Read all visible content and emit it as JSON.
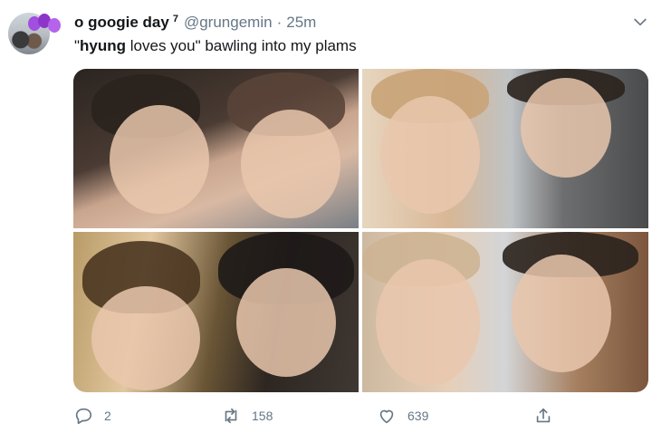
{
  "tweet": {
    "display_name": "o googie day",
    "superscript": "7",
    "handle": "@grungemin",
    "separator": "·",
    "time": "25m",
    "text_quote_open": "\"",
    "text_bold": "hyung",
    "text_rest": " loves you\" bawling into my plams"
  },
  "actions": {
    "replies": "2",
    "retweets": "158",
    "likes": "639"
  },
  "colors": {
    "text": "#14171a",
    "muted": "#657786",
    "background": "#ffffff"
  },
  "icons": {
    "caret": "chevron-down-icon",
    "reply": "reply-icon",
    "retweet": "retweet-icon",
    "like": "heart-icon",
    "share": "share-icon"
  }
}
